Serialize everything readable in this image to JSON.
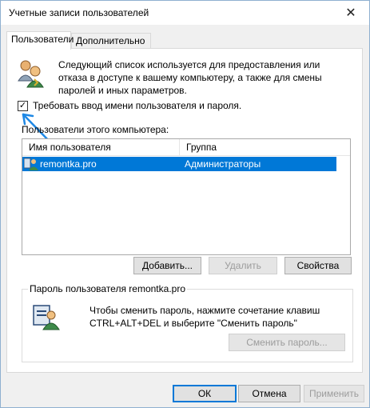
{
  "window": {
    "title": "Учетные записи пользователей",
    "close_glyph": "✕"
  },
  "tabs": [
    {
      "label": "Пользователи"
    },
    {
      "label": "Дополнительно"
    }
  ],
  "description": "Следующий список используется для предоставления или отказа в доступе к вашему компьютеру, а также для смены паролей и иных параметров.",
  "require_login": {
    "label": "Требовать ввод имени пользователя и пароля.",
    "checked": true,
    "check_glyph": "✓"
  },
  "users_list": {
    "label": "Пользователи этого компьютера:",
    "columns": [
      "Имя пользователя",
      "Группа"
    ],
    "rows": [
      {
        "name": "remontka.pro",
        "group": "Администраторы",
        "selected": true
      }
    ]
  },
  "buttons": {
    "add": "Добавить...",
    "remove": "Удалить",
    "properties": "Свойства"
  },
  "password_group": {
    "title": "Пароль пользователя remontka.pro",
    "text": "Чтобы сменить пароль, нажмите сочетание клавиш CTRL+ALT+DEL и выберите \"Сменить пароль\"",
    "change_button": "Сменить пароль..."
  },
  "footer": {
    "ok": "ОК",
    "cancel": "Отмена",
    "apply": "Применить"
  },
  "colors": {
    "selection": "#0078d7",
    "annotation_arrow": "#1e88e5"
  }
}
